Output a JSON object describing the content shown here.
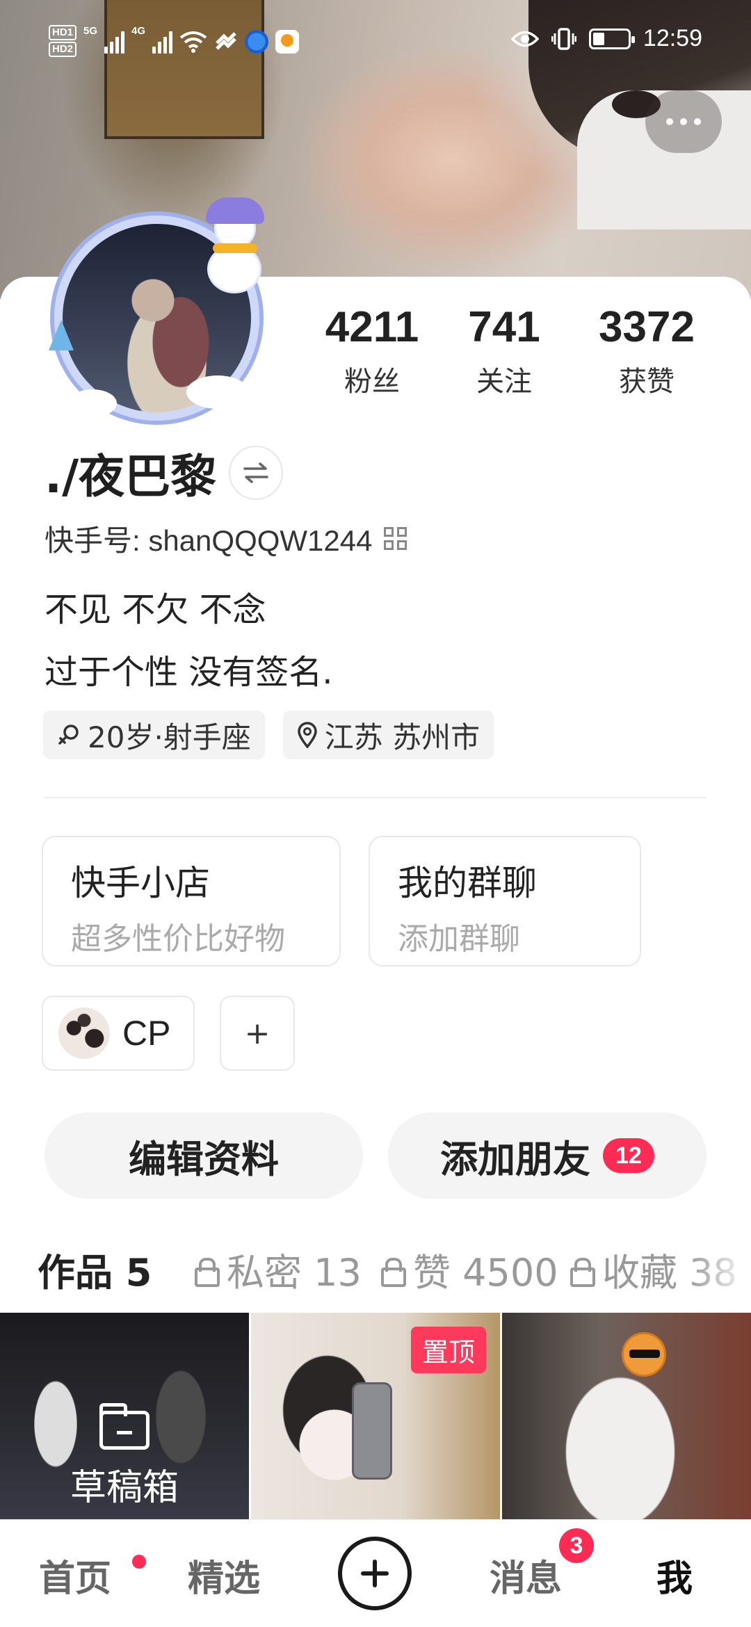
{
  "status_bar": {
    "hd1": "HD1",
    "hd2": "HD2",
    "net1": "5G",
    "net2": "4G",
    "time": "12:59",
    "icons": [
      "signal-icon",
      "wifi-icon",
      "eye-icon",
      "vibrate-icon",
      "battery-icon"
    ]
  },
  "profile": {
    "name": "./夜巴黎",
    "kuaishou_id": "快手号: shanQQQW1244",
    "bio_line1": "不见 不欠 不念",
    "bio_line2": "过于个性  没有签名.",
    "tag_age": "20岁·射手座",
    "tag_location": "江苏 苏州市"
  },
  "stats": [
    {
      "value": "4211",
      "label": "粉丝"
    },
    {
      "value": "741",
      "label": "关注"
    },
    {
      "value": "3372",
      "label": "获赞"
    }
  ],
  "cards": {
    "shop_title": "快手小店",
    "shop_sub": "超多性价比好物",
    "group_title": "我的群聊",
    "group_sub": "添加群聊"
  },
  "cp": {
    "label": "CP",
    "add": "+"
  },
  "actions": {
    "edit": "编辑资料",
    "add_friend": "添加朋友",
    "add_friend_badge": "12"
  },
  "tabs": [
    {
      "label": "作品 5"
    },
    {
      "label": "私密 13"
    },
    {
      "label": "赞 4500"
    },
    {
      "label": "收藏 38"
    }
  ],
  "grid": {
    "draft_label": "草稿箱",
    "pinned_label": "置顶"
  },
  "bottom_nav": {
    "home": "首页",
    "featured": "精选",
    "messages": "消息",
    "messages_badge": "3",
    "me": "我"
  },
  "colors": {
    "accent": "#fe2c55",
    "pin": "#fe3a5c"
  }
}
